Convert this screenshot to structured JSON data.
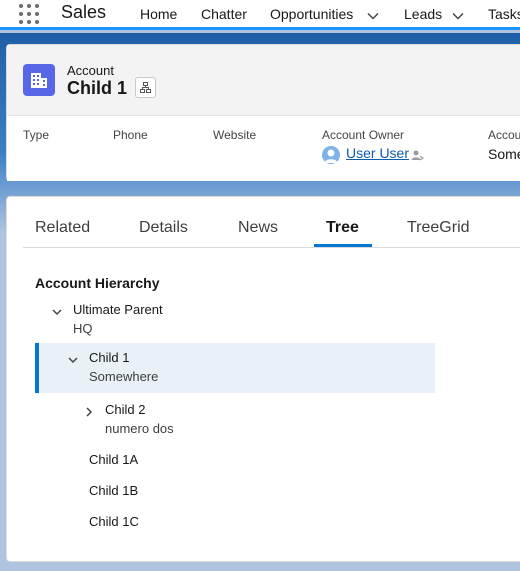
{
  "app": {
    "name": "Sales",
    "nav_items": [
      {
        "label": "Home"
      },
      {
        "label": "Chatter"
      },
      {
        "label": "Opportunities"
      },
      {
        "label": "Leads"
      },
      {
        "label": "Tasks"
      }
    ]
  },
  "record": {
    "object_type": "Account",
    "name": "Child 1",
    "icon": "account-icon",
    "fields": [
      {
        "label": "Type",
        "value": ""
      },
      {
        "label": "Phone",
        "value": ""
      },
      {
        "label": "Website",
        "value": ""
      },
      {
        "label": "Account Owner",
        "value": "User User"
      },
      {
        "label": "Accou",
        "value": "Some"
      }
    ]
  },
  "tabs": [
    {
      "label": "Related",
      "active": false
    },
    {
      "label": "Details",
      "active": false
    },
    {
      "label": "News",
      "active": false
    },
    {
      "label": "Tree",
      "active": true
    },
    {
      "label": "TreeGrid",
      "active": false
    }
  ],
  "tree": {
    "title": "Account Hierarchy",
    "nodes": [
      {
        "label": "Ultimate Parent",
        "meta": "HQ",
        "expanded": true,
        "selected": false
      },
      {
        "label": "Child 1",
        "meta": "Somewhere",
        "expanded": true,
        "selected": true
      },
      {
        "label": "Child 2",
        "meta": "numero dos",
        "expanded": false,
        "selected": false
      },
      {
        "label": "Child 1A",
        "meta": "",
        "expanded": false,
        "selected": false
      },
      {
        "label": "Child 1B",
        "meta": "",
        "expanded": false,
        "selected": false
      },
      {
        "label": "Child 1C",
        "meta": "",
        "expanded": false,
        "selected": false
      }
    ]
  },
  "colors": {
    "brand_blue": "#0176d3",
    "account_icon_bg": "#5867e8",
    "selected_row_bg": "#eaf0f8",
    "link": "#0b5cab"
  }
}
